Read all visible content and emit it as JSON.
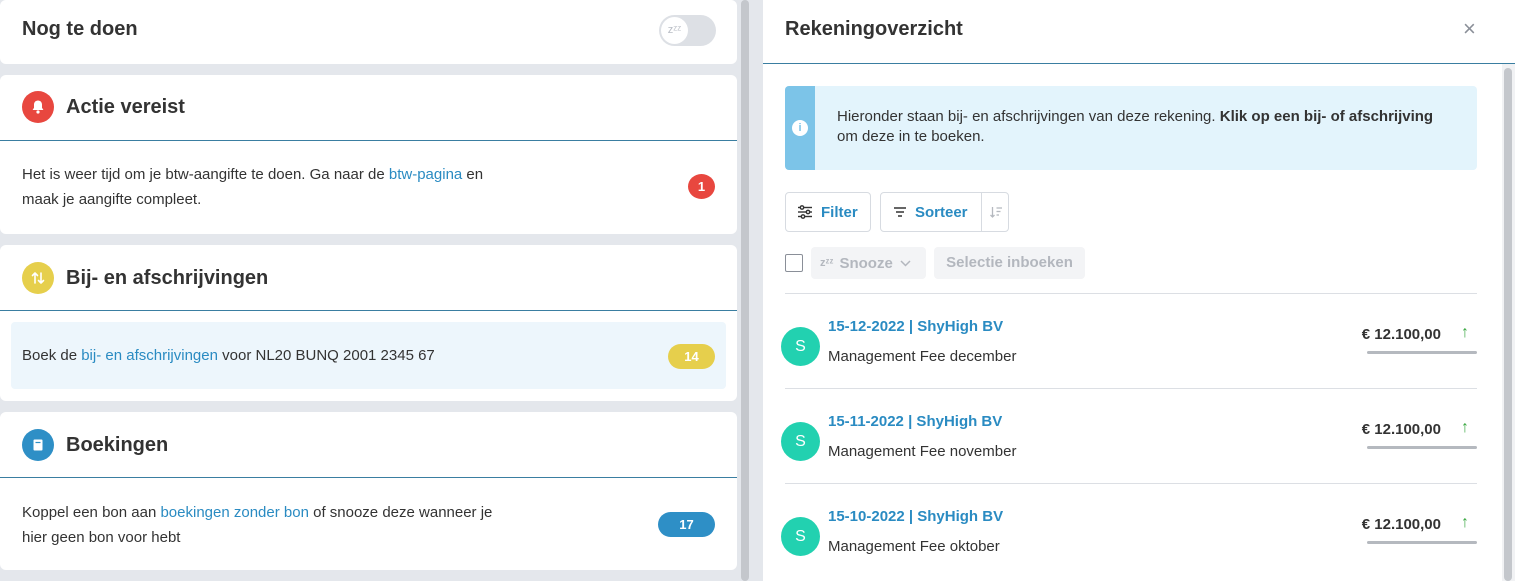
{
  "todo": {
    "title": "Nog te doen",
    "snooze_icon": "zᶻᶻ"
  },
  "action": {
    "title": "Actie vereist",
    "text_before": "Het is weer tijd om je btw-aangifte te doen. Ga naar de ",
    "link": "btw-pagina",
    "text_after": " en",
    "text_line2": "maak je aangifte compleet.",
    "count": "1",
    "color": "#e8473f"
  },
  "transactions": {
    "title": "Bij- en afschrijvingen",
    "text_before": "Boek de ",
    "link": "bij- en afschrijvingen",
    "text_after": " voor NL20 BUNQ 2001 2345 67",
    "count": "14",
    "color": "#e6cf4c"
  },
  "bookings": {
    "title": "Boekingen",
    "text_before": "Koppel een bon aan ",
    "link": "boekingen zonder bon",
    "text_after": " of snooze deze wanneer je",
    "text_line2": "hier geen bon voor hebt",
    "count": "17",
    "color": "#2e8fc6"
  },
  "panel": {
    "title": "Rekeningoverzicht",
    "close": "×",
    "info_plain": "Hieronder staan bij- en afschrijvingen van deze rekening. ",
    "info_bold": "Klik op een bij- of afschrijving",
    "info_after": " om deze in te boeken.",
    "filter_label": "Filter",
    "sort_label": "Sorteer",
    "snooze_label": "Snooze",
    "snooze_icon": "zᶻᶻ",
    "selection_label": "Selectie inboeken"
  },
  "rows": [
    {
      "avatar": "S",
      "title": "15-12-2022 | ShyHigh BV",
      "desc": "Management Fee december",
      "amount": "€ 12.100,00"
    },
    {
      "avatar": "S",
      "title": "15-11-2022 | ShyHigh BV",
      "desc": "Management Fee november",
      "amount": "€ 12.100,00"
    },
    {
      "avatar": "S",
      "title": "15-10-2022 | ShyHigh BV",
      "desc": "Management Fee oktober",
      "amount": "€ 12.100,00"
    }
  ]
}
